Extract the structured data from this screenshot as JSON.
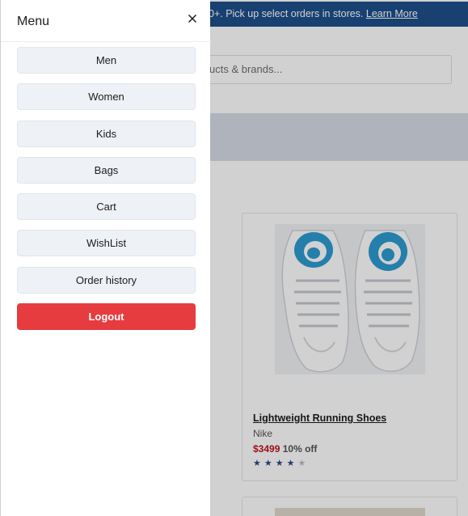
{
  "banner": {
    "text": "0+. Pick up select orders in stores. ",
    "link": "Learn More"
  },
  "search": {
    "placeholder": "ucts & brands..."
  },
  "product": {
    "title": "Lightweight Running Shoes",
    "brand": "Nike",
    "price": "$3499",
    "discount": "10% off",
    "rating": 4,
    "rating_max": 5,
    "image_icon": "sneaker-image"
  },
  "drawer": {
    "title": "Menu",
    "close_icon": "close-icon",
    "items": [
      {
        "label": "Men"
      },
      {
        "label": "Women"
      },
      {
        "label": "Kids"
      },
      {
        "label": "Bags"
      },
      {
        "label": "Cart"
      },
      {
        "label": "WishList"
      },
      {
        "label": "Order history"
      }
    ],
    "logout": "Logout"
  },
  "colors": {
    "banner": "#1e4f8a",
    "logout": "#e63c3f",
    "menu_button": "#eef1f5",
    "price": "#c1121f"
  }
}
